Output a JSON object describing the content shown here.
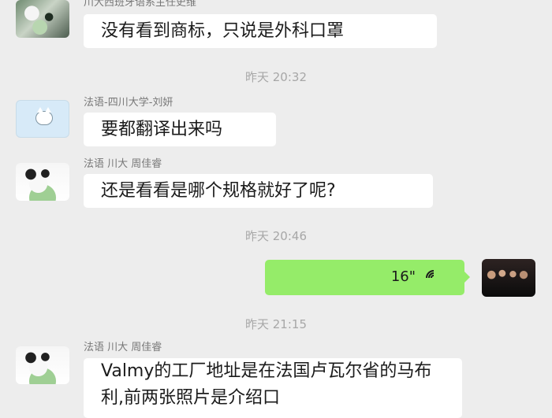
{
  "messages": [
    {
      "sender": "川大西班牙语系主任史维",
      "text": "没有看到商标，只说是外科口罩"
    },
    {
      "sender": "法语-四川大学-刘妍",
      "text": "要都翻译出来吗"
    },
    {
      "sender": "法语 川大 周佳睿",
      "text": "还是看看是哪个规格就好了呢?"
    },
    {
      "voice_duration": "16\""
    },
    {
      "sender": "法语 川大 周佳睿",
      "text": "Valmy的工厂地址是在法国卢瓦尔省的马布利,前两张照片是介绍口"
    }
  ],
  "timestamps": [
    "昨天 20:32",
    "昨天 20:46",
    "昨天 21:15"
  ]
}
